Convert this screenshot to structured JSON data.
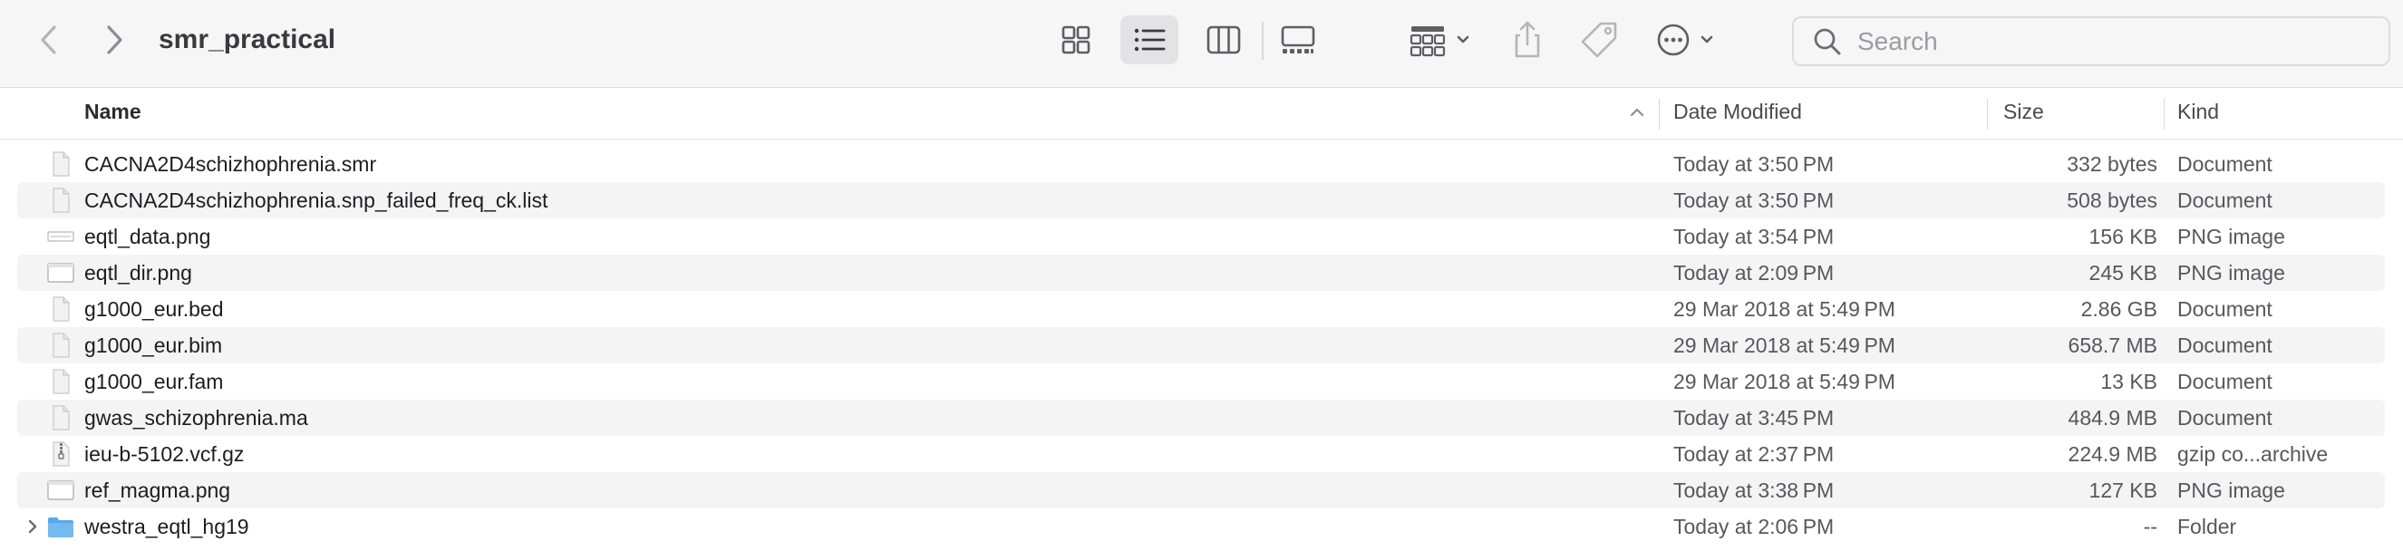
{
  "window": {
    "title": "smr_practical"
  },
  "toolbar": {
    "back_icon": "chevron-left-icon",
    "forward_icon": "chevron-right-icon",
    "view_modes": [
      "icon-view-icon",
      "list-view-icon",
      "column-view-icon",
      "gallery-view-icon"
    ],
    "active_view": "list-view-icon",
    "group_icon": "group-by-icon",
    "share_icon": "share-icon",
    "tag_icon": "tag-icon",
    "more_icon": "more-actions-icon"
  },
  "search": {
    "placeholder": "Search",
    "value": ""
  },
  "columns": {
    "name": "Name",
    "date": "Date Modified",
    "size": "Size",
    "kind": "Kind"
  },
  "files": [
    {
      "name": "CACNA2D4schizhophrenia.smr",
      "date": "Today at 3:50 PM",
      "size": "332 bytes",
      "kind": "Document",
      "icon": "document-icon"
    },
    {
      "name": "CACNA2D4schizhophrenia.snp_failed_freq_ck.list",
      "date": "Today at 3:50 PM",
      "size": "508 bytes",
      "kind": "Document",
      "icon": "document-icon"
    },
    {
      "name": "eqtl_data.png",
      "date": "Today at 3:54 PM",
      "size": "156 KB",
      "kind": "PNG image",
      "icon": "image-thumbnail-icon"
    },
    {
      "name": "eqtl_dir.png",
      "date": "Today at 2:09 PM",
      "size": "245 KB",
      "kind": "PNG image",
      "icon": "image-thumbnail-icon"
    },
    {
      "name": "g1000_eur.bed",
      "date": "29 Mar 2018 at 5:49 PM",
      "size": "2.86 GB",
      "kind": "Document",
      "icon": "document-icon"
    },
    {
      "name": "g1000_eur.bim",
      "date": "29 Mar 2018 at 5:49 PM",
      "size": "658.7 MB",
      "kind": "Document",
      "icon": "document-icon"
    },
    {
      "name": "g1000_eur.fam",
      "date": "29 Mar 2018 at 5:49 PM",
      "size": "13 KB",
      "kind": "Document",
      "icon": "document-icon"
    },
    {
      "name": "gwas_schizophrenia.ma",
      "date": "Today at 3:45 PM",
      "size": "484.9 MB",
      "kind": "Document",
      "icon": "document-icon"
    },
    {
      "name": "ieu-b-5102.vcf.gz",
      "date": "Today at 2:37 PM",
      "size": "224.9 MB",
      "kind": "gzip co...archive",
      "icon": "archive-icon"
    },
    {
      "name": "ref_magma.png",
      "date": "Today at 3:38 PM",
      "size": "127 KB",
      "kind": "PNG image",
      "icon": "image-thumbnail-icon"
    },
    {
      "name": "westra_eqtl_hg19",
      "date": "Today at 2:06 PM",
      "size": "--",
      "kind": "Folder",
      "icon": "folder-icon"
    }
  ]
}
